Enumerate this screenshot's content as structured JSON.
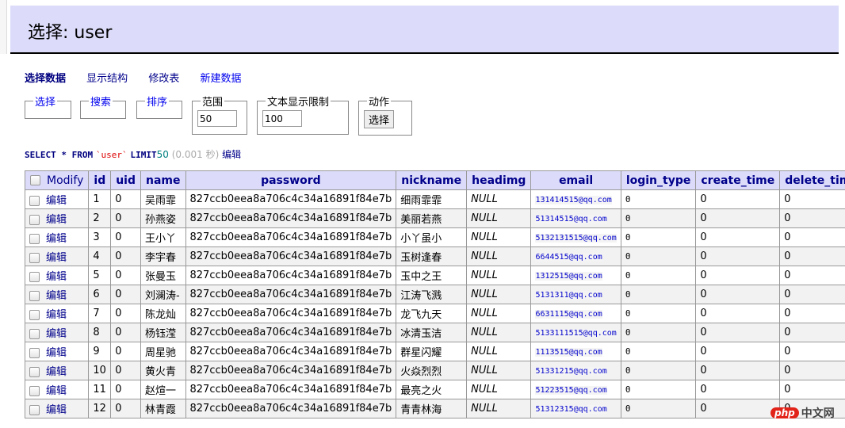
{
  "header": {
    "title": "选择: user"
  },
  "tabs": [
    {
      "label": "选择数据",
      "active": true
    },
    {
      "label": "显示结构"
    },
    {
      "label": "修改表"
    },
    {
      "label": "新建数据"
    }
  ],
  "fieldsets": {
    "select": {
      "legend": "选择"
    },
    "search": {
      "legend": "搜索"
    },
    "sort": {
      "legend": "排序"
    },
    "limit": {
      "legend": "范围",
      "value": "50"
    },
    "text_limit": {
      "legend": "文本显示限制",
      "value": "100"
    },
    "action": {
      "legend": "动作",
      "button": "选择"
    }
  },
  "sql": {
    "select": "SELECT * FROM",
    "table": "`user`",
    "limit_kw": "LIMIT",
    "limit_val": "50",
    "time": "(0.001 秒)",
    "edit": "编辑"
  },
  "table": {
    "modify_label": "Modify",
    "columns": [
      "id",
      "uid",
      "name",
      "password",
      "nickname",
      "headimg",
      "email",
      "login_type",
      "create_time",
      "delete_time"
    ],
    "edit_label": "编辑",
    "rows": [
      {
        "id": "1",
        "uid": "0",
        "name": "吴雨霏",
        "password": "827ccb0eea8a706c4c34a16891f84e7b",
        "nickname": "细雨霏霏",
        "headimg": "NULL",
        "email": "131414515@qq.com",
        "login_type": "0",
        "create_time": "0",
        "delete_time": "0"
      },
      {
        "id": "2",
        "uid": "0",
        "name": "孙燕姿",
        "password": "827ccb0eea8a706c4c34a16891f84e7b",
        "nickname": "美丽若燕",
        "headimg": "NULL",
        "email": "51314515@qq.com",
        "login_type": "0",
        "create_time": "0",
        "delete_time": "0"
      },
      {
        "id": "3",
        "uid": "0",
        "name": "王小丫",
        "password": "827ccb0eea8a706c4c34a16891f84e7b",
        "nickname": "小丫虽小",
        "headimg": "NULL",
        "email": "5132131515@qq.com",
        "login_type": "0",
        "create_time": "0",
        "delete_time": "0"
      },
      {
        "id": "4",
        "uid": "0",
        "name": "李宇春",
        "password": "827ccb0eea8a706c4c34a16891f84e7b",
        "nickname": "玉树逢春",
        "headimg": "NULL",
        "email": "6644515@qq.com",
        "login_type": "0",
        "create_time": "0",
        "delete_time": "0"
      },
      {
        "id": "5",
        "uid": "0",
        "name": "张曼玉",
        "password": "827ccb0eea8a706c4c34a16891f84e7b",
        "nickname": "玉中之王",
        "headimg": "NULL",
        "email": "1312515@qq.com",
        "login_type": "0",
        "create_time": "0",
        "delete_time": "0"
      },
      {
        "id": "6",
        "uid": "0",
        "name": "刘澜涛-",
        "password": "827ccb0eea8a706c4c34a16891f84e7b",
        "nickname": "江涛飞溅",
        "headimg": "NULL",
        "email": "5131311@qq.com",
        "login_type": "0",
        "create_time": "0",
        "delete_time": "0"
      },
      {
        "id": "7",
        "uid": "0",
        "name": "陈龙灿",
        "password": "827ccb0eea8a706c4c34a16891f84e7b",
        "nickname": "龙飞九天",
        "headimg": "NULL",
        "email": "6631115@qq.com",
        "login_type": "0",
        "create_time": "0",
        "delete_time": "0"
      },
      {
        "id": "8",
        "uid": "0",
        "name": "杨钰滢",
        "password": "827ccb0eea8a706c4c34a16891f84e7b",
        "nickname": "冰清玉洁",
        "headimg": "NULL",
        "email": "5133111515@qq.com",
        "login_type": "0",
        "create_time": "0",
        "delete_time": "0"
      },
      {
        "id": "9",
        "uid": "0",
        "name": "周星驰",
        "password": "827ccb0eea8a706c4c34a16891f84e7b",
        "nickname": "群星闪耀",
        "headimg": "NULL",
        "email": "1113515@qq.com",
        "login_type": "0",
        "create_time": "0",
        "delete_time": "0"
      },
      {
        "id": "10",
        "uid": "0",
        "name": "黄火青",
        "password": "827ccb0eea8a706c4c34a16891f84e7b",
        "nickname": "火焱烈烈",
        "headimg": "NULL",
        "email": "51331215@qq.com",
        "login_type": "0",
        "create_time": "0",
        "delete_time": "0"
      },
      {
        "id": "11",
        "uid": "0",
        "name": "赵煊一",
        "password": "827ccb0eea8a706c4c34a16891f84e7b",
        "nickname": "最亮之火",
        "headimg": "NULL",
        "email": "51223515@qq.com",
        "login_type": "0",
        "create_time": "0",
        "delete_time": "0"
      },
      {
        "id": "12",
        "uid": "0",
        "name": "林青霞",
        "password": "827ccb0eea8a706c4c34a16891f84e7b",
        "nickname": "青青林海",
        "headimg": "NULL",
        "email": "51312315@qq.com",
        "login_type": "0",
        "create_time": "0",
        "delete_time": "0"
      }
    ]
  },
  "watermark": {
    "php": "php",
    "cn": "中文网"
  }
}
